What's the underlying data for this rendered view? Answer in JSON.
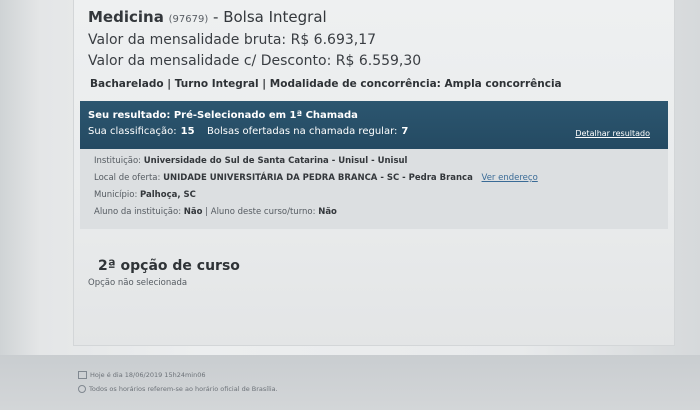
{
  "course": {
    "name": "Medicina",
    "code": "(97679)",
    "scholarship": "- Bolsa Integral",
    "gross_label": "Valor da mensalidade bruta:",
    "gross_value": "R$ 6.693,17",
    "discount_label": "Valor da mensalidade c/ Desconto:",
    "discount_value": "R$ 6.559,30",
    "modality": "Bacharelado | Turno Integral | Modalidade de concorrência: Ampla concorrência"
  },
  "result": {
    "label": "Seu resultado:",
    "value": "Pré-Selecionado em 1ª Chamada",
    "class_label": "Sua classificação:",
    "class_value": "15",
    "offered_label": "Bolsas ofertadas na chamada regular:",
    "offered_value": "7",
    "detail_link": "Detalhar resultado"
  },
  "info": {
    "institution_label": "Instituição:",
    "institution_value": "Universidade do Sul de Santa Catarina - Unisul - Unisul",
    "offer_place_label": "Local de oferta:",
    "offer_place_value": "UNIDADE UNIVERSITÁRIA DA PEDRA BRANCA - SC - Pedra Branca",
    "address_link": "Ver endereço",
    "city_label": "Município:",
    "city_value": "Palhoça, SC",
    "student_inst_label": "Aluno da instituição:",
    "student_inst_value": "Não",
    "separator": "|",
    "student_course_label": "Aluno deste curso/turno:",
    "student_course_value": "Não"
  },
  "option2": {
    "title": "2ª opção de curso",
    "subtitle": "Opção não selecionada"
  },
  "footer": {
    "date_line": "Hoje é dia 18/06/2019 15h24min06",
    "tz_line": "Todos os horários referem-se ao horário oficial de Brasília."
  }
}
